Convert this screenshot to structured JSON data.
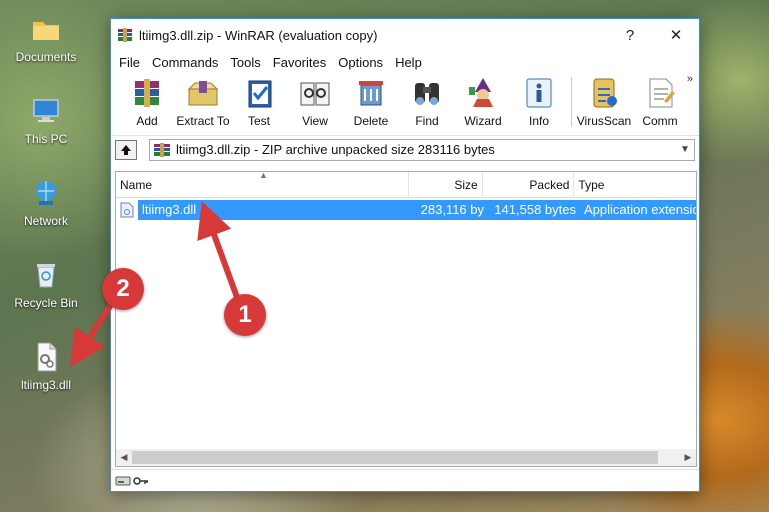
{
  "desktop": {
    "icons": [
      {
        "label": "Documents",
        "icon": "folder-icon"
      },
      {
        "label": "This PC",
        "icon": "computer-icon"
      },
      {
        "label": "Network",
        "icon": "network-icon"
      },
      {
        "label": "Recycle Bin",
        "icon": "recycle-bin-icon"
      },
      {
        "label": "ltiimg3.dll",
        "icon": "dll-file-icon"
      }
    ]
  },
  "window": {
    "title": "ltiimg3.dll.zip - WinRAR (evaluation copy)",
    "help_button": "?",
    "close_button": "✕",
    "menu": [
      "File",
      "Commands",
      "Tools",
      "Favorites",
      "Options",
      "Help"
    ],
    "toolbar": [
      {
        "label": "Add",
        "icon": "add-archive-icon"
      },
      {
        "label": "Extract To",
        "icon": "extract-icon"
      },
      {
        "label": "Test",
        "icon": "test-icon"
      },
      {
        "label": "View",
        "icon": "view-icon"
      },
      {
        "label": "Delete",
        "icon": "delete-icon"
      },
      {
        "label": "Find",
        "icon": "find-icon"
      },
      {
        "label": "Wizard",
        "icon": "wizard-icon"
      },
      {
        "label": "Info",
        "icon": "info-icon"
      },
      {
        "label": "VirusScan",
        "icon": "virusscan-icon"
      },
      {
        "label": "Comm",
        "icon": "comment-icon"
      }
    ],
    "toolbar_more": "»",
    "path": "ltiimg3.dll.zip - ZIP archive unpacked size 283116 bytes",
    "columns": {
      "name": "Name",
      "size": "Size",
      "packed": "Packed",
      "type": "Type"
    },
    "files": [
      {
        "name": "ltiimg3.dll",
        "size": "283,116 by",
        "packed": "141,558 bytes",
        "type": "Application extension"
      }
    ]
  },
  "annotations": {
    "marker_1": "1",
    "marker_2": "2"
  },
  "colors": {
    "selection": "#3399ff",
    "window_border": "#3b8fd8",
    "marker": "#d73838"
  }
}
